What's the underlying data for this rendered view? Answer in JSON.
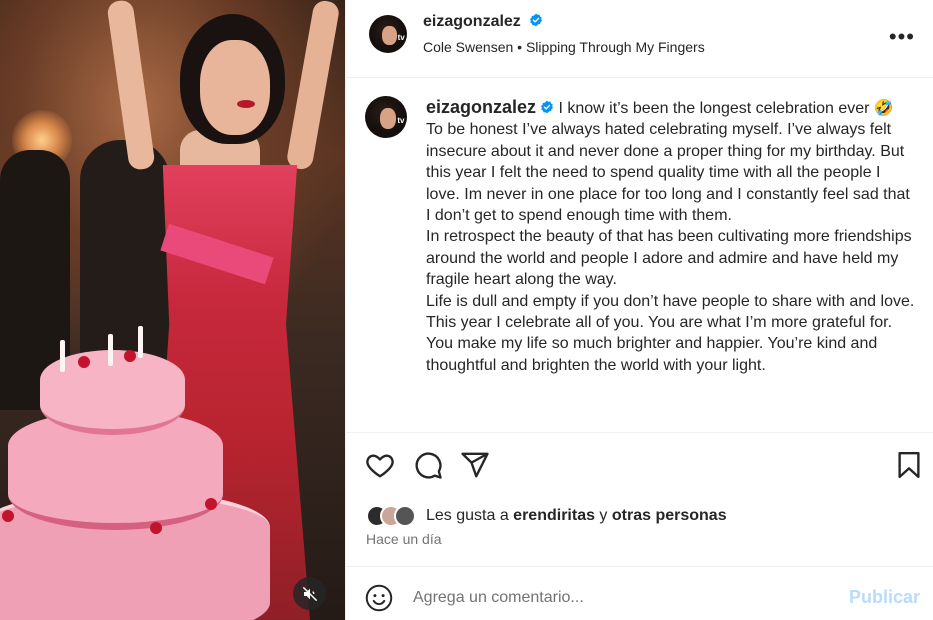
{
  "post": {
    "username": "eizagonzalez",
    "music_artist": "Cole Swensen",
    "music_separator": " • ",
    "music_track": "Slipping Through My Fingers",
    "more_label": "•••",
    "avatar_badge": "tv"
  },
  "caption": {
    "username": "eizagonzalez",
    "first_line": " I know it’s been the longest celebration ever 🤣",
    "paragraphs": [
      "To be honest I’ve always hated celebrating myself. I’ve always felt insecure about it and never done a proper thing for my birthday. But this year I felt the need to spend quality time with all the people I love. Im never in one place for too long and I constantly feel sad that I don’t get to spend enough time with them.",
      "In retrospect the beauty of that has been cultivating more friendships around the world and people I adore and admire and have held my fragile heart along the way.",
      "Life is dull and empty if you don’t have people to share with and love.",
      "This year I celebrate all of you. You are what I’m more grateful for. You make my life so much brighter and happier. You’re kind and thoughtful and brighten the world with your light."
    ]
  },
  "actions": {
    "icons": [
      "heart-icon",
      "comment-icon",
      "share-icon",
      "bookmark-icon"
    ]
  },
  "likes": {
    "prefix": "Les gusta a ",
    "first_user": "erendiritas",
    "middle": " y ",
    "others": "otras personas"
  },
  "timestamp": "Hace un día",
  "comment": {
    "placeholder": "Agrega un comentario...",
    "post_label": "Publicar"
  },
  "colors": {
    "verified": "#0095f6",
    "post_button_disabled": "#b9dcfb",
    "secondary_text": "#737373"
  }
}
